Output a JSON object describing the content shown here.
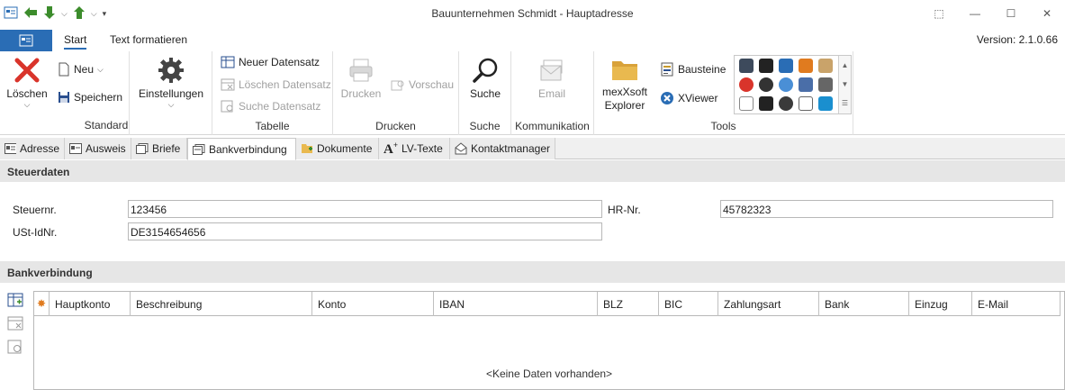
{
  "window": {
    "title": "Bauunternehmen Schmidt - Hauptadresse"
  },
  "ribbon_tabs": {
    "start": "Start",
    "text_format": "Text formatieren"
  },
  "version": "Version: 2.1.0.66",
  "groups": {
    "standard": {
      "label": "Standard",
      "loeschen": "Löschen",
      "neu": "Neu",
      "speichern": "Speichern",
      "einstellungen": "Einstellungen"
    },
    "tabelle": {
      "label": "Tabelle",
      "neuer": "Neuer Datensatz",
      "loeschen": "Löschen Datensatz",
      "suche": "Suche Datensatz"
    },
    "drucken": {
      "label": "Drucken",
      "drucken": "Drucken",
      "vorschau": "Vorschau"
    },
    "suche": {
      "label": "Suche",
      "suche": "Suche"
    },
    "kommunikation": {
      "label": "Kommunikation",
      "email": "Email"
    },
    "tools": {
      "label": "Tools",
      "explorer_line1": "mexXsoft",
      "explorer_line2": "Explorer",
      "bausteine": "Bausteine",
      "xviewer": "XViewer"
    }
  },
  "doc_tabs": [
    "Adresse",
    "Ausweis",
    "Briefe",
    "Bankverbindung",
    "Dokumente",
    "LV-Texte",
    "Kontaktmanager"
  ],
  "steuer": {
    "header": "Steuerdaten",
    "steuernr_label": "Steuernr.",
    "steuernr": "123456",
    "ustid_label": "USt-IdNr.",
    "ustid": "DE3154654656",
    "hrnr_label": "HR-Nr.",
    "hrnr": "45782323"
  },
  "bank": {
    "header": "Bankverbindung",
    "columns": [
      "Hauptkonto",
      "Beschreibung",
      "Konto",
      "IBAN",
      "BLZ",
      "BIC",
      "Zahlungsart",
      "Bank",
      "Einzug",
      "E-Mail"
    ],
    "empty": "<Keine Daten vorhanden>"
  },
  "colors": {
    "accent": "#2a6db5",
    "delete_red": "#d9342b",
    "save_green": "#3c8c2c"
  }
}
